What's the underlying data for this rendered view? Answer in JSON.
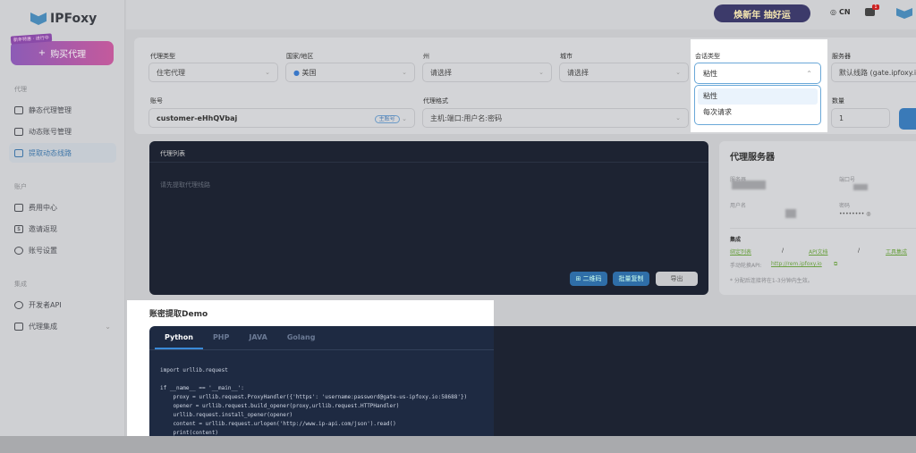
{
  "sidebar": {
    "brand": "IPFoxy",
    "buy_tag": "新年特惠 · 进行中",
    "buy_label": "购买代理",
    "sections": [
      {
        "title": "代理",
        "items": [
          {
            "label": "静态代理管理"
          },
          {
            "label": "动态账号管理"
          },
          {
            "label": "提取动态线路",
            "active": true
          }
        ]
      },
      {
        "title": "账户",
        "items": [
          {
            "label": "费用中心"
          },
          {
            "label": "邀请返现"
          },
          {
            "label": "账号设置"
          }
        ]
      },
      {
        "title": "集成",
        "items": [
          {
            "label": "开发者API"
          },
          {
            "label": "代理集成"
          }
        ]
      }
    ]
  },
  "topbar": {
    "banner": "焕新年 抽好运",
    "lang": "CN",
    "notification_count": "1"
  },
  "form": {
    "proxy_type": {
      "label": "代理类型",
      "value": "住宅代理"
    },
    "country": {
      "label": "国家/地区",
      "value": "美国"
    },
    "state": {
      "label": "州",
      "value": "请选择"
    },
    "city": {
      "label": "城市",
      "value": "请选择"
    },
    "session": {
      "label": "会话类型",
      "value": "粘性",
      "options": [
        "粘性",
        "每次请求"
      ]
    },
    "server": {
      "label": "服务器",
      "value": "默认线路 (gate.ipfoxy.io"
    },
    "account": {
      "label": "账号",
      "value": "customer-eHhQVbaj",
      "tag": "主账号"
    },
    "format": {
      "label": "代理格式",
      "value": "主机:端口:用户名:密码"
    },
    "quantity": {
      "label": "数量",
      "value": "1"
    }
  },
  "proxy_list": {
    "title": "代理列表",
    "placeholder": "请先提取代理线路",
    "qr_button": "二维码",
    "copy_button": "批量复制",
    "export_button": "导出"
  },
  "server_panel": {
    "title": "代理服务器",
    "host_label": "服务器",
    "port_label": "端口号",
    "user_label": "用户名",
    "pass_label": "密码",
    "password_mask": "••••••••",
    "integration_title": "集成",
    "links": [
      "绑定列表",
      "API文档",
      "工具集成"
    ],
    "manual_api_label": "手动轮换API:",
    "manual_api_url": "http://rem.ipfoxy.io",
    "note": "* 分配后连接将在1-3分钟内生效。"
  },
  "demo": {
    "title": "账密提取Demo",
    "tabs": [
      "Python",
      "PHP",
      "JAVA",
      "Golang"
    ],
    "code": "import urllib.request\n\nif __name__ == '__main__':\n    proxy = urllib.request.ProxyHandler({'https': 'username:password@gate-us-ipfoxy.io:58688'})\n    opener = urllib.request.build_opener(proxy,urllib.request.HTTPHandler)\n    urllib.request.install_opener(opener)\n    content = urllib.request.urlopen('http://www.ip-api.com/json').read()\n    print(content)"
  }
}
